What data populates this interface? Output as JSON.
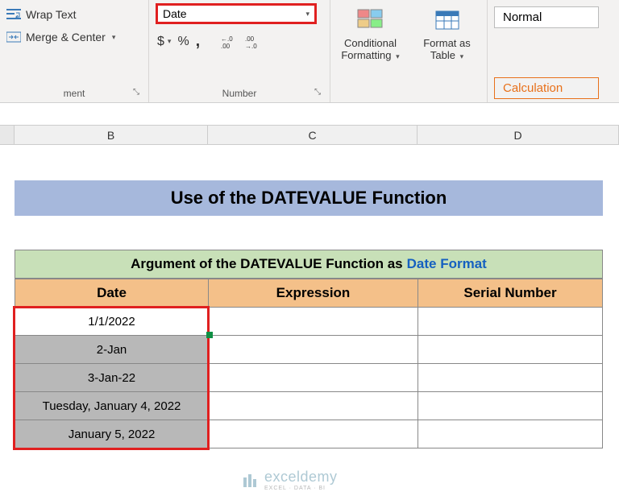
{
  "ribbon": {
    "alignment": {
      "wrap_text": "Wrap Text",
      "merge_center": "Merge & Center",
      "group_label": "ment"
    },
    "number": {
      "format_value": "Date",
      "currency": "$",
      "percent": "%",
      "comma": ",",
      "inc_dec": ".0",
      "dec_inc": ".00",
      "group_label": "Number"
    },
    "styles": {
      "conditional": "Conditional",
      "conditional2": "Formatting",
      "format_table": "Format as",
      "format_table2": "Table"
    },
    "cell_styles": {
      "normal": "Normal",
      "calculation": "Calculation"
    }
  },
  "columns": {
    "b": "B",
    "c": "C",
    "d": "D"
  },
  "sheet": {
    "title": "Use of the DATEVALUE Function",
    "subtitle_prefix": "Argument of the DATEVALUE Function as ",
    "subtitle_emph": "Date Format",
    "headers": {
      "date": "Date",
      "expression": "Expression",
      "serial": "Serial Number"
    },
    "rows": [
      {
        "date": "1/1/2022",
        "shaded": false
      },
      {
        "date": "2-Jan",
        "shaded": true
      },
      {
        "date": "3-Jan-22",
        "shaded": true
      },
      {
        "date": "Tuesday, January 4, 2022",
        "shaded": true
      },
      {
        "date": "January 5, 2022",
        "shaded": true
      }
    ]
  },
  "watermark": {
    "name": "exceldemy",
    "tagline": "EXCEL · DATA · BI"
  }
}
